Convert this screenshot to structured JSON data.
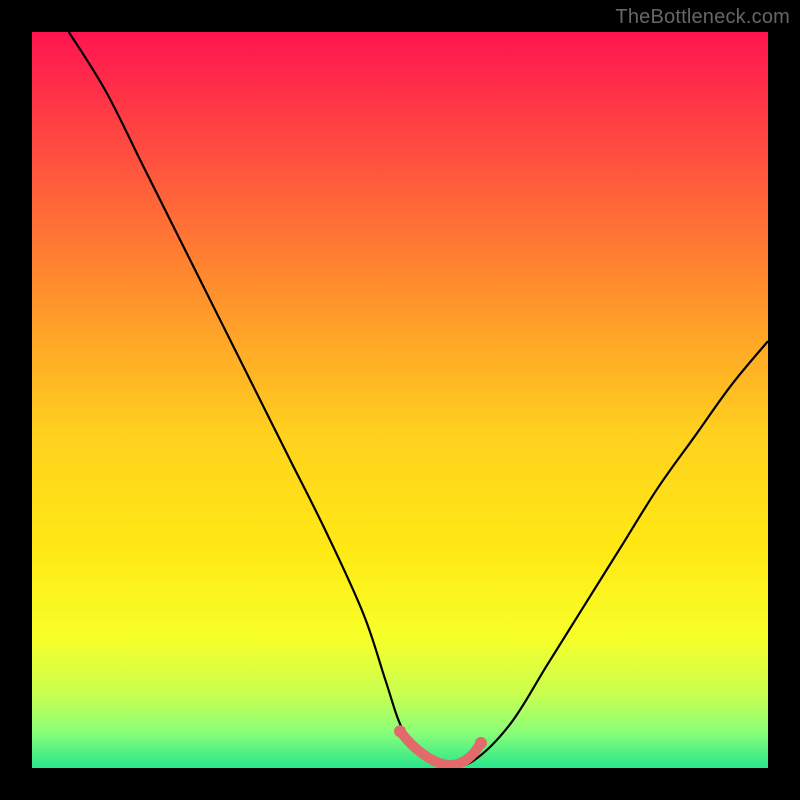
{
  "watermark": "TheBottleneck.com",
  "colors": {
    "frame": "#000000",
    "curve": "#000000",
    "highlight": "#e26a6a",
    "gradient_stops": [
      {
        "offset": 0.0,
        "color": "#ff1450"
      },
      {
        "offset": 0.2,
        "color": "#ff5a3c"
      },
      {
        "offset": 0.4,
        "color": "#ffa028"
      },
      {
        "offset": 0.55,
        "color": "#ffd21e"
      },
      {
        "offset": 0.7,
        "color": "#ffe814"
      },
      {
        "offset": 0.82,
        "color": "#f8ff28"
      },
      {
        "offset": 0.9,
        "color": "#c8ff50"
      },
      {
        "offset": 0.95,
        "color": "#8cff78"
      },
      {
        "offset": 1.0,
        "color": "#28e68c"
      }
    ]
  },
  "chart_data": {
    "type": "line",
    "title": "",
    "xlabel": "",
    "ylabel": "",
    "xlim": [
      0,
      100
    ],
    "ylim": [
      0,
      100
    ],
    "series": [
      {
        "name": "curve",
        "x": [
          5,
          10,
          15,
          20,
          25,
          30,
          35,
          40,
          45,
          48,
          50,
          52,
          55,
          57,
          60,
          65,
          70,
          75,
          80,
          85,
          90,
          95,
          100
        ],
        "y": [
          100,
          92,
          82,
          72,
          62,
          52,
          42,
          32,
          21,
          12,
          6,
          3,
          1,
          0.5,
          1,
          6,
          14,
          22,
          30,
          38,
          45,
          52,
          58
        ]
      },
      {
        "name": "highlighted-minimum",
        "x": [
          50,
          51,
          52,
          53,
          54,
          55,
          56,
          57,
          58,
          59,
          60,
          61
        ],
        "y": [
          5.0,
          3.8,
          2.8,
          2.0,
          1.3,
          0.8,
          0.5,
          0.4,
          0.6,
          1.1,
          2.0,
          3.4
        ]
      }
    ],
    "minimum": {
      "x": 57,
      "y": 0.4
    }
  }
}
